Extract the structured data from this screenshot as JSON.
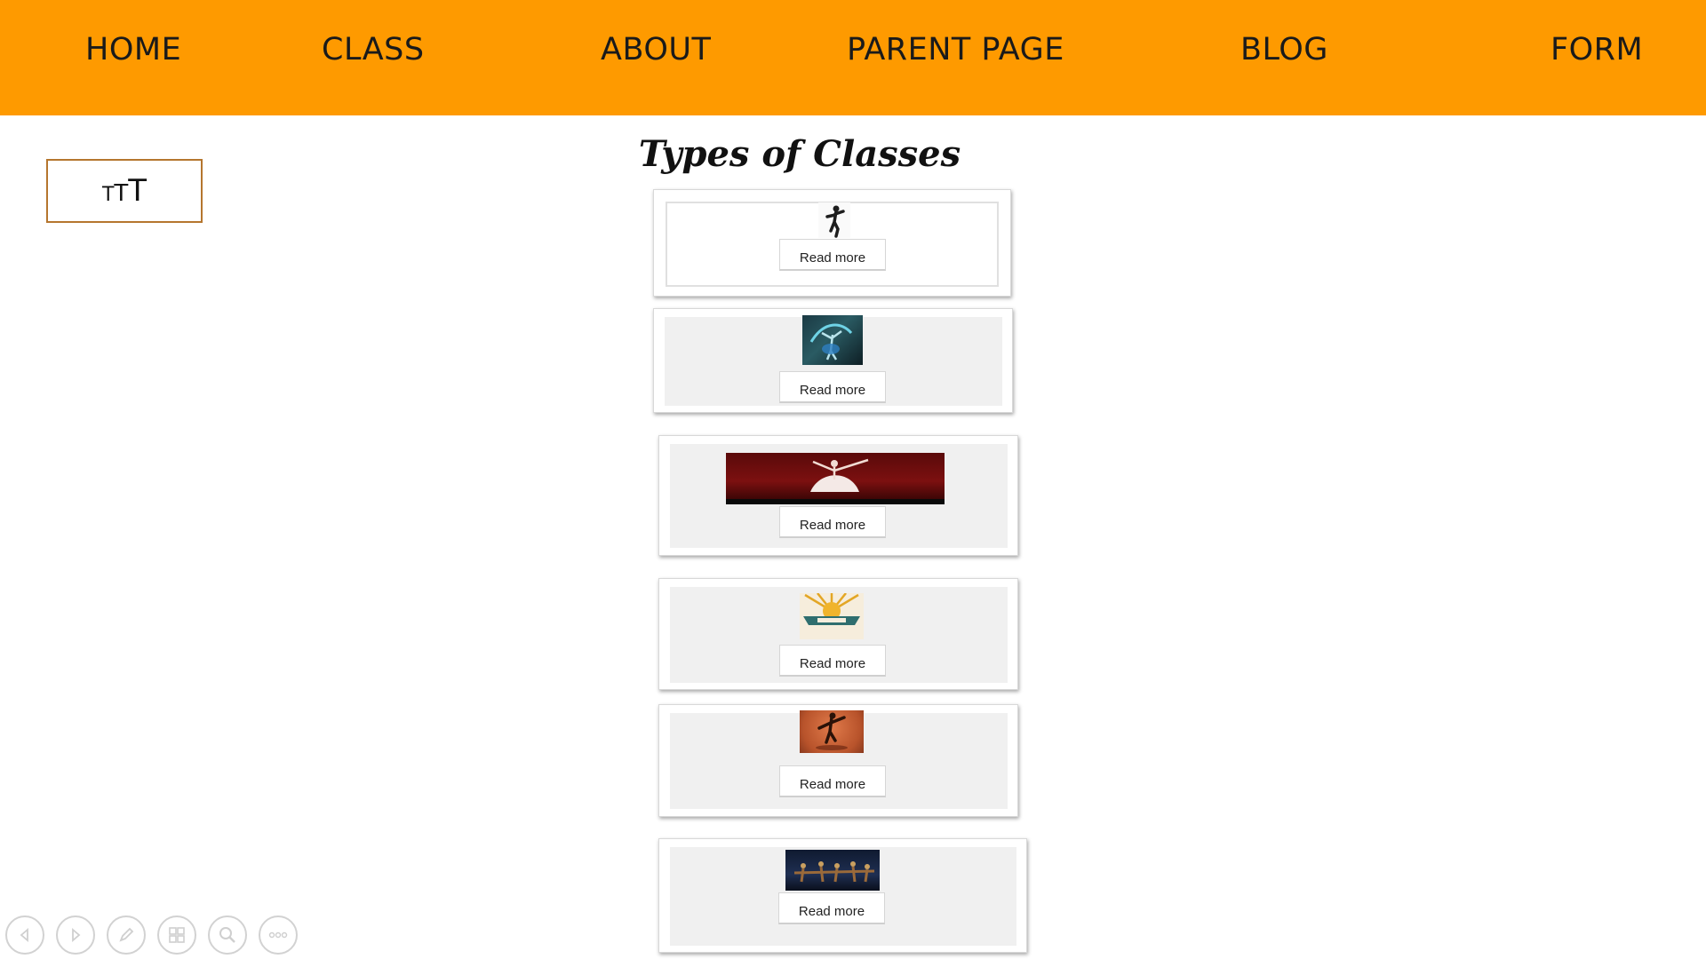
{
  "nav": {
    "items": [
      {
        "label": "HOME"
      },
      {
        "label": "CLASS"
      },
      {
        "label": "ABOUT"
      },
      {
        "label": "PARENT PAGE"
      },
      {
        "label": "BLOG"
      },
      {
        "label": "FORM"
      }
    ],
    "background_color": "#fe9a00"
  },
  "logo": {
    "glyphs": [
      "T",
      "T",
      "T"
    ],
    "border_color": "#b5762e"
  },
  "section": {
    "title": "Types of Classes"
  },
  "cards": [
    {
      "thumb": "dancer-kick-thumbnail",
      "button_label": "Read more"
    },
    {
      "thumb": "dancer-blue-light-thumbnail",
      "button_label": "Read more"
    },
    {
      "thumb": "ballerina-white-dress-thumbnail",
      "button_label": "Read more"
    },
    {
      "thumb": "tap-dancing-badge-thumbnail",
      "button_label": "Read more"
    },
    {
      "thumb": "dancer-orange-stage-thumbnail",
      "button_label": "Read more"
    },
    {
      "thumb": "dance-group-stage-thumbnail",
      "button_label": "Read more"
    }
  ],
  "controls": [
    {
      "icon": "previous-arrow-icon"
    },
    {
      "icon": "next-arrow-icon"
    },
    {
      "icon": "pen-icon"
    },
    {
      "icon": "slides-grid-icon"
    },
    {
      "icon": "zoom-icon"
    },
    {
      "icon": "more-options-icon"
    }
  ]
}
